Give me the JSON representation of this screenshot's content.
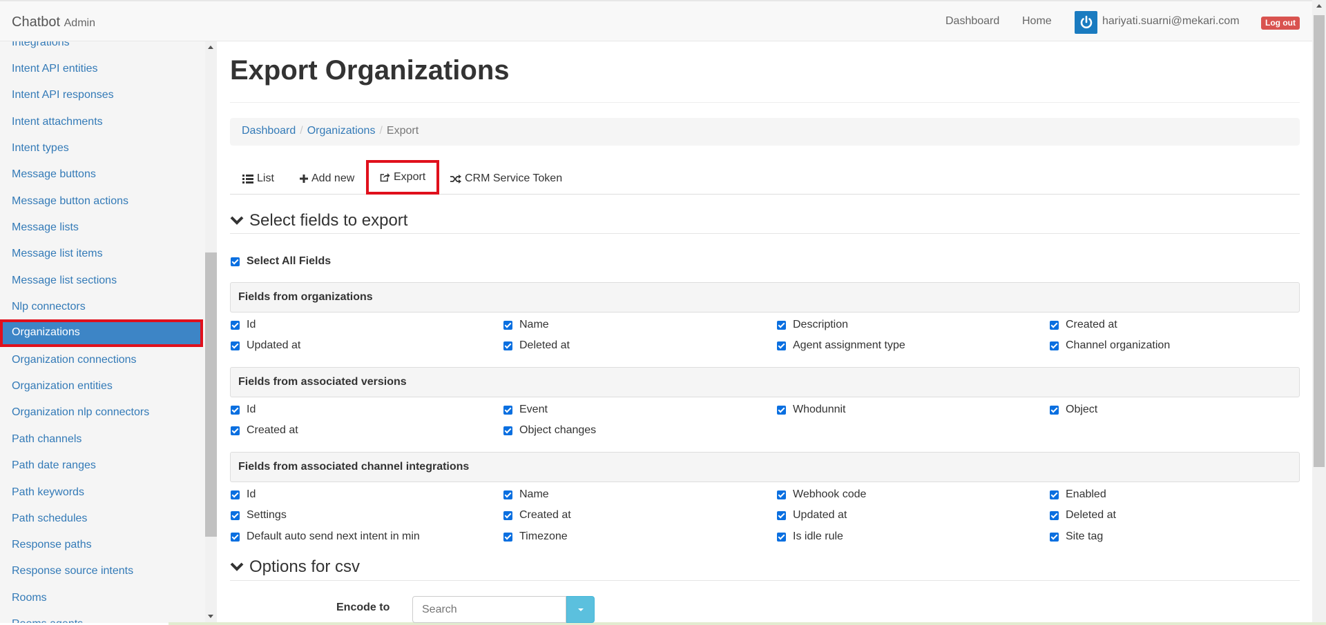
{
  "navbar": {
    "brand": "Chatbot",
    "brand_small": "Admin",
    "links": [
      "Dashboard",
      "Home"
    ],
    "user_email": "hariyati.suarni@mekari.com",
    "logout_label": "Log out"
  },
  "sidebar": {
    "items": [
      {
        "label": "Integrations",
        "active": false
      },
      {
        "label": "Intent API entities",
        "active": false
      },
      {
        "label": "Intent API responses",
        "active": false
      },
      {
        "label": "Intent attachments",
        "active": false
      },
      {
        "label": "Intent types",
        "active": false
      },
      {
        "label": "Message buttons",
        "active": false
      },
      {
        "label": "Message button actions",
        "active": false
      },
      {
        "label": "Message lists",
        "active": false
      },
      {
        "label": "Message list items",
        "active": false
      },
      {
        "label": "Message list sections",
        "active": false
      },
      {
        "label": "Nlp connectors",
        "active": false
      },
      {
        "label": "Organizations",
        "active": true
      },
      {
        "label": "Organization connections",
        "active": false
      },
      {
        "label": "Organization entities",
        "active": false
      },
      {
        "label": "Organization nlp connectors",
        "active": false
      },
      {
        "label": "Path channels",
        "active": false
      },
      {
        "label": "Path date ranges",
        "active": false
      },
      {
        "label": "Path keywords",
        "active": false
      },
      {
        "label": "Path schedules",
        "active": false
      },
      {
        "label": "Response paths",
        "active": false
      },
      {
        "label": "Response source intents",
        "active": false
      },
      {
        "label": "Rooms",
        "active": false
      },
      {
        "label": "Rooms agents",
        "active": false
      }
    ]
  },
  "page": {
    "title": "Export Organizations"
  },
  "breadcrumb": {
    "items": [
      "Dashboard",
      "Organizations"
    ],
    "active": "Export"
  },
  "tabs": {
    "list": "List",
    "add_new": "Add new",
    "export": "Export",
    "crm": "CRM Service Token"
  },
  "select_fields": {
    "heading": "Select fields to export",
    "select_all": "Select All Fields",
    "groups": [
      {
        "title": "Fields from organizations",
        "fields": [
          "Id",
          "Name",
          "Description",
          "Created at",
          "Updated at",
          "Deleted at",
          "Agent assignment type",
          "Channel organization"
        ]
      },
      {
        "title": "Fields from associated versions",
        "fields": [
          "Id",
          "Event",
          "Whodunnit",
          "Object",
          "Created at",
          "Object changes"
        ]
      },
      {
        "title": "Fields from associated channel integrations",
        "fields": [
          "Id",
          "Name",
          "Webhook code",
          "Enabled",
          "Settings",
          "Created at",
          "Updated at",
          "Deleted at",
          "Default auto send next intent in min",
          "Timezone",
          "Is idle rule",
          "Site tag"
        ]
      }
    ]
  },
  "csv_options": {
    "heading": "Options for csv",
    "encode_label": "Encode to",
    "encode_placeholder": "Search"
  }
}
